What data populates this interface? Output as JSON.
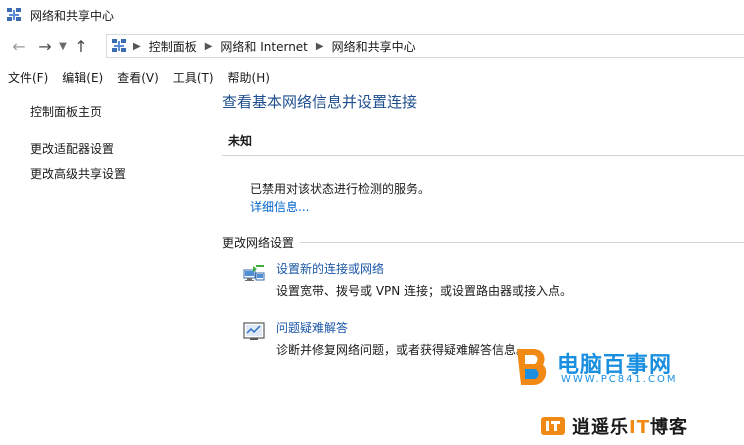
{
  "window": {
    "title": "网络和共享中心",
    "icon": "network-icon"
  },
  "nav": {
    "back_icon": "arrow-left-icon",
    "forward_icon": "arrow-right-icon",
    "recent_icon": "chevron-down-icon",
    "up_icon": "arrow-up-icon"
  },
  "breadcrumb": {
    "items": [
      "控制面板",
      "网络和 Internet",
      "网络和共享中心"
    ]
  },
  "menubar": {
    "items": [
      "文件(F)",
      "编辑(E)",
      "查看(V)",
      "工具(T)",
      "帮助(H)"
    ]
  },
  "sidebar": {
    "items": [
      "控制面板主页",
      "更改适配器设置",
      "更改高级共享设置"
    ]
  },
  "main": {
    "title": "查看基本网络信息并设置连接",
    "network_name": "未知",
    "status": "已禁用对该状态进行检测的服务。",
    "details_link": "详细信息...",
    "section_title": "更改网络设置",
    "tasks": [
      {
        "icon": "new-connection-icon",
        "link": "设置新的连接或网络",
        "desc": "设置宽带、拨号或 VPN 连接；或设置路由器或接入点。"
      },
      {
        "icon": "troubleshoot-icon",
        "link": "问题疑难解答",
        "desc": "诊断并修复网络问题，或者获得疑难解答信息。"
      }
    ]
  },
  "watermarks": {
    "brand1": "电脑百事网",
    "url1": "WWW.PC841.COM",
    "brand2_part1": "逍遥乐",
    "brand2_part2": "IT",
    "brand2_part3": "博客"
  },
  "colors": {
    "title_blue": "#1f4f8f",
    "link_blue": "#1a56a6",
    "watermark_blue": "#1a8fe0",
    "watermark_orange": "#f08a14"
  }
}
